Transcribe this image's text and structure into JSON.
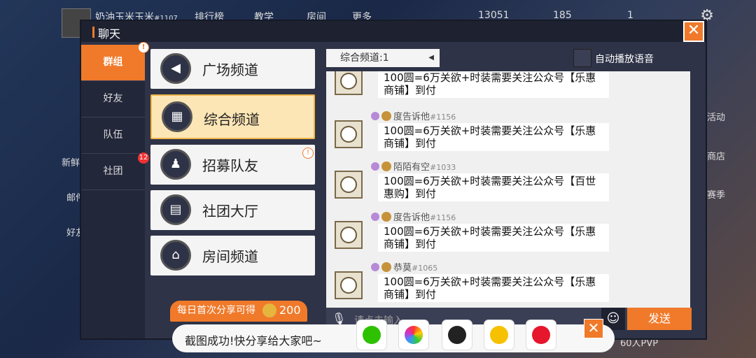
{
  "game": {
    "username": "奶油玉米玉米",
    "user_id": "#1107",
    "tabs": [
      "排行榜",
      "教学",
      "房间",
      "更多"
    ],
    "coins": "13051",
    "gems": "185",
    "count": "1",
    "side_left": [
      "新鲜",
      "邮件",
      "好友"
    ],
    "side_right": [
      "活动",
      "商店",
      "赛季"
    ],
    "bottom_right": "60人PVP"
  },
  "dialog": {
    "title": "聊天"
  },
  "nav": {
    "items": [
      {
        "label": "群组"
      },
      {
        "label": "好友"
      },
      {
        "label": "队伍"
      },
      {
        "label": "社团"
      }
    ],
    "badge": "12"
  },
  "channels": [
    {
      "label": "广场频道",
      "icon": "speaker-icon"
    },
    {
      "label": "综合频道",
      "icon": "grid-icon"
    },
    {
      "label": "招募队友",
      "icon": "users-icon"
    },
    {
      "label": "社团大厅",
      "icon": "banner-icon"
    },
    {
      "label": "房间频道",
      "icon": "home-icon"
    }
  ],
  "selector": {
    "label": "综合频道:1"
  },
  "auto_play": {
    "label": "自动播放语音"
  },
  "messages": [
    {
      "name": "",
      "uid": "",
      "text1": "100圆=6万关欲+时装需要关注公众号【乐惠",
      "text2": "商铺】到付"
    },
    {
      "name": "度告诉他",
      "uid": "#1156",
      "text1": "100圆=6万关欲+时装需要关注公众号【乐惠",
      "text2": "商铺】到付"
    },
    {
      "name": "陌陌有空",
      "uid": "#1033",
      "text1": "100圆=6万关欲+时装需要关注公众号【百世",
      "text2": "惠购】到付"
    },
    {
      "name": "度告诉他",
      "uid": "#1156",
      "text1": "100圆=6万关欲+时装需要关注公众号【乐惠",
      "text2": "商铺】到付"
    },
    {
      "name": "恭莫",
      "uid": "#1065",
      "text1": "100圆=6万关欲+时装需要关注公众号【乐惠",
      "text2": "商铺】到付"
    }
  ],
  "input": {
    "placeholder": "请点击输入"
  },
  "send": {
    "label": "发送"
  },
  "promo": {
    "text": "每日首次分享可得",
    "amount": "200"
  },
  "toast": {
    "text": "截图成功!快分享给大家吧~"
  },
  "colors": {
    "accent": "#f07a2a",
    "panel": "#2e3347"
  }
}
